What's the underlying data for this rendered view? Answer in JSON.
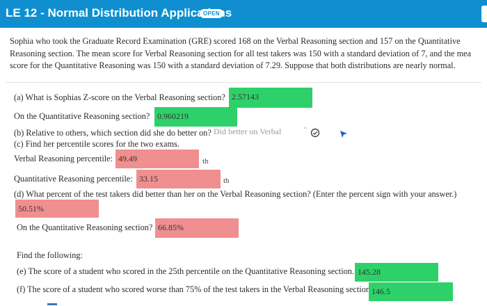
{
  "header": {
    "title": "LE 12 - Normal Distribution Applications",
    "badge": "OPEN",
    "color": "#0f8fd0"
  },
  "problem": {
    "lines": [
      "Sophia who took the Graduate Record Examination (GRE) scored 168 on the Verbal Reasoning section and 157 on the Quantitative",
      "Reasoning section. The mean score for Verbal Reasoning section for all test takers was 150 with a standard deviation of 7, and the mea",
      "score for the Quantitative Reasoning was 150 with a standard deviation of 7.29. Suppose that both distributions are nearly normal."
    ]
  },
  "questions": {
    "a_label": "(a) What is Sophias Z-score on the Verbal Reasoning section?",
    "a_answer": "2.57143",
    "a2_label": "On the Quantitative Reasoning section?",
    "a2_answer": "0.960219",
    "b_label": "(b) Relative to others, which section did she do better on?",
    "b_answer": "Did better on Verbal",
    "c_label": "(c) Find her percentile scores for the two exams.",
    "c1_label": "Verbal Reasoning percentile:",
    "c1_answer": "49.49",
    "c1_suffix": "th",
    "c2_label": "Quantitative Reasoning percentile:",
    "c2_answer": "33.15",
    "c2_suffix": "th",
    "d_label": "(d) What percent of the test takers did better than her on the Verbal Reasoning section? (Enter the percent sign with your answer.)",
    "d_answer": "50.51%",
    "d2_label": "On the Quantitative Reasoning section?",
    "d2_answer": "66.85%",
    "find_label": "Find the following:",
    "e_label": "(e) The score of a student who scored in the 25th percentile on the Quantitative Reasoning section.",
    "e_answer": "145.28",
    "f_label": "(f) The score of a student who scored worse than 75% of the test takers in the Verbal Reasoning section.",
    "f_answer": "146.5"
  },
  "colors": {
    "correct": "#2ed169",
    "incorrect": "#f08f8f"
  }
}
